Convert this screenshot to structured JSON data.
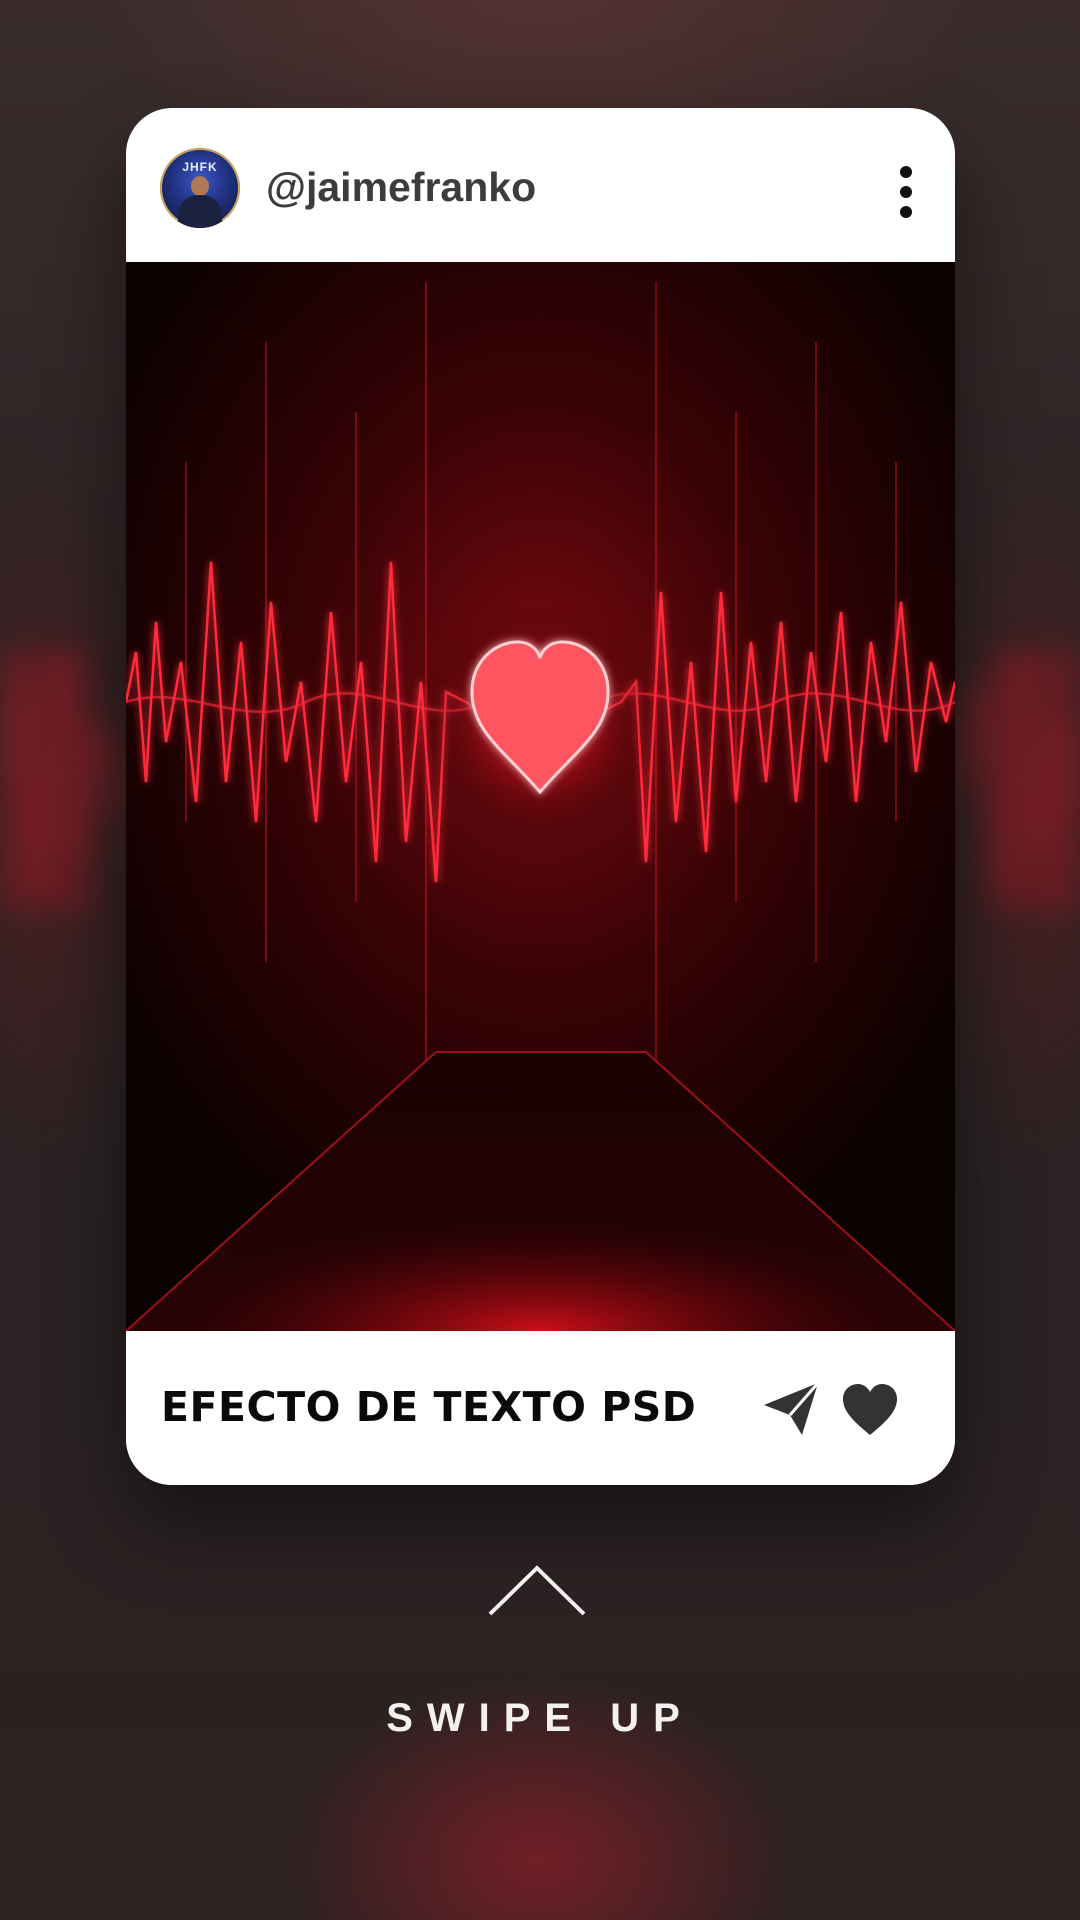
{
  "profile": {
    "username": "@jaimefranko",
    "avatar_badge": "JHFK",
    "avatar_icon": "user-avatar",
    "more_icon": "vertical-ellipsis-icon"
  },
  "post": {
    "image_subject": "glowing red heart with heartbeat waveform",
    "caption": "EFECTO DE TEXTO PSD",
    "share_icon": "paper-plane-icon",
    "like_icon": "heart-icon"
  },
  "swipe": {
    "label": "SWIPE UP",
    "icon": "chevron-up-icon"
  },
  "colors": {
    "background": "#2a2324",
    "card": "#ffffff",
    "accent_red": "#ff2a3a",
    "icon_dark": "#333333",
    "username": "#3c3c3c",
    "caption": "#0a0a0a"
  }
}
